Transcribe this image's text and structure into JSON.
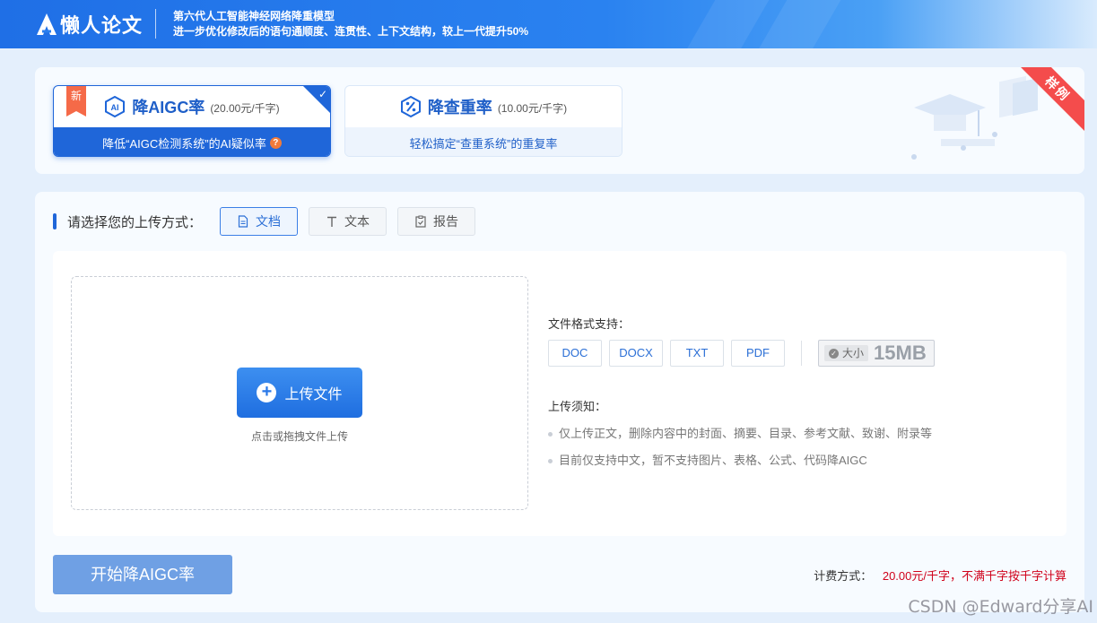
{
  "header": {
    "logo_text": "懒人论文",
    "slogan_line1": "第六代人工智能神经网络降重模型",
    "slogan_line2": "进一步优化修改后的语句通顺度、连贯性、上下文结构，较上一代提升50%"
  },
  "modes": {
    "aigc": {
      "new_badge": "新",
      "title": "降AIGC率",
      "price": "(20.00元/千字)",
      "subtitle": "降低“AIGC检测系统”的AI疑似率",
      "help": "?",
      "icon": "ai-icon",
      "selected": true
    },
    "dupe": {
      "title": "降查重率",
      "price": "(10.00元/千字)",
      "subtitle": "轻松搞定“查重系统”的重复率",
      "icon": "percent-icon"
    },
    "sample_ribbon": "样例"
  },
  "upload": {
    "method_label": "请选择您的上传方式：",
    "methods": [
      {
        "label": "文档",
        "icon": "document-icon",
        "active": true
      },
      {
        "label": "文本",
        "icon": "text-icon",
        "active": false
      },
      {
        "label": "报告",
        "icon": "report-icon",
        "active": false
      }
    ],
    "upload_button": "上传文件",
    "upload_hint": "点击或拖拽文件上传",
    "format_title": "文件格式支持：",
    "formats": [
      "DOC",
      "DOCX",
      "TXT",
      "PDF"
    ],
    "size_label": "大小",
    "size_value": "15MB",
    "notice_title": "上传须知：",
    "notices": [
      "仅上传正文，删除内容中的封面、摘要、目录、参考文献、致谢、附录等",
      "目前仅支持中文，暂不支持图片、表格、公式、代码降AIGC"
    ]
  },
  "footer": {
    "start_button": "开始降AIGC率",
    "pricing_label": "计费方式：",
    "pricing_value": "20.00元/千字，不满千字按千字计算"
  },
  "watermark": "CSDN @Edward分享AI",
  "colors": {
    "brand": "#1f66d9",
    "start_button": "#6fa0e4",
    "price": "#d0021b",
    "ribbon": "#f44c4c"
  }
}
